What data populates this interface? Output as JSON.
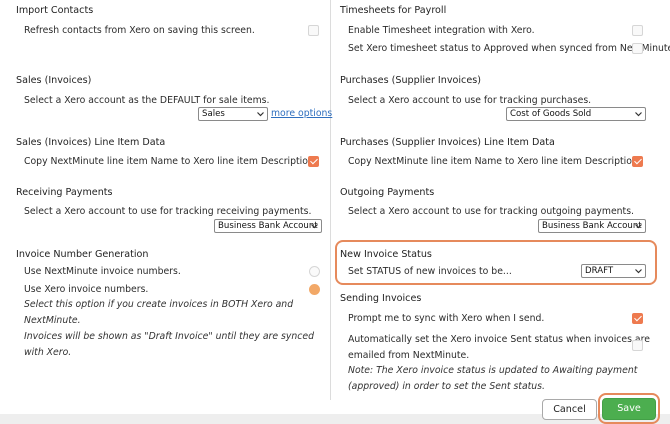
{
  "left": {
    "import_contacts": {
      "title": "Import Contacts",
      "refresh_label": "Refresh contacts from Xero on saving this screen."
    },
    "sales_invoices": {
      "title": "Sales (Invoices)",
      "desc": "Select a Xero account as the DEFAULT for sale items.",
      "select_value": "Sales",
      "more_options": "more options"
    },
    "sales_line_items": {
      "title": "Sales (Invoices) Line Item Data",
      "copy_label": "Copy NextMinute line item Name to Xero line item Description."
    },
    "receiving_payments": {
      "title": "Receiving Payments",
      "desc": "Select a Xero account to use for tracking receiving payments.",
      "select_value": "Business Bank Account"
    },
    "invoice_number": {
      "title": "Invoice Number Generation",
      "option1": "Use NextMinute invoice numbers.",
      "option2": "Use Xero invoice numbers.",
      "note_line1": "Select this option if you create invoices in BOTH Xero and NextMinute.",
      "note_line2": "Invoices will be shown as \"Draft Invoice\" until they are synced with Xero."
    }
  },
  "right": {
    "timesheets": {
      "title": "Timesheets for Payroll",
      "enable_label": "Enable Timesheet integration with Xero.",
      "approved_label": "Set Xero timesheet status to Approved when synced from NextMinute."
    },
    "purchases": {
      "title": "Purchases (Supplier Invoices)",
      "desc": "Select a Xero account to use for tracking purchases.",
      "select_value": "Cost of Goods Sold"
    },
    "purchases_line_items": {
      "title": "Purchases (Supplier Invoices) Line Item Data",
      "copy_label": "Copy NextMinute line item Name to Xero line item Description."
    },
    "outgoing_payments": {
      "title": "Outgoing Payments",
      "desc": "Select a Xero account to use for tracking outgoing payments.",
      "select_value": "Business Bank Account"
    },
    "new_invoice_status": {
      "title": "New Invoice Status",
      "desc": "Set STATUS of new invoices to be...",
      "select_value": "DRAFT"
    },
    "sending_invoices": {
      "title": "Sending Invoices",
      "prompt_label": "Prompt me to sync with Xero when I send.",
      "auto_line1": "Automatically set the Xero invoice Sent status when invoices are",
      "auto_line2": "emailed from NextMinute.",
      "note_line1": "Note: The Xero invoice status is updated to Awaiting payment",
      "note_line2": "(approved) in order to set the Sent status."
    }
  },
  "footer": {
    "cancel_label": "Cancel",
    "save_label": "Save"
  },
  "colors": {
    "accent": "#ee7a4f",
    "highlight": "#e68a5c",
    "save": "#4cae4f",
    "link": "#2f6fbf"
  }
}
